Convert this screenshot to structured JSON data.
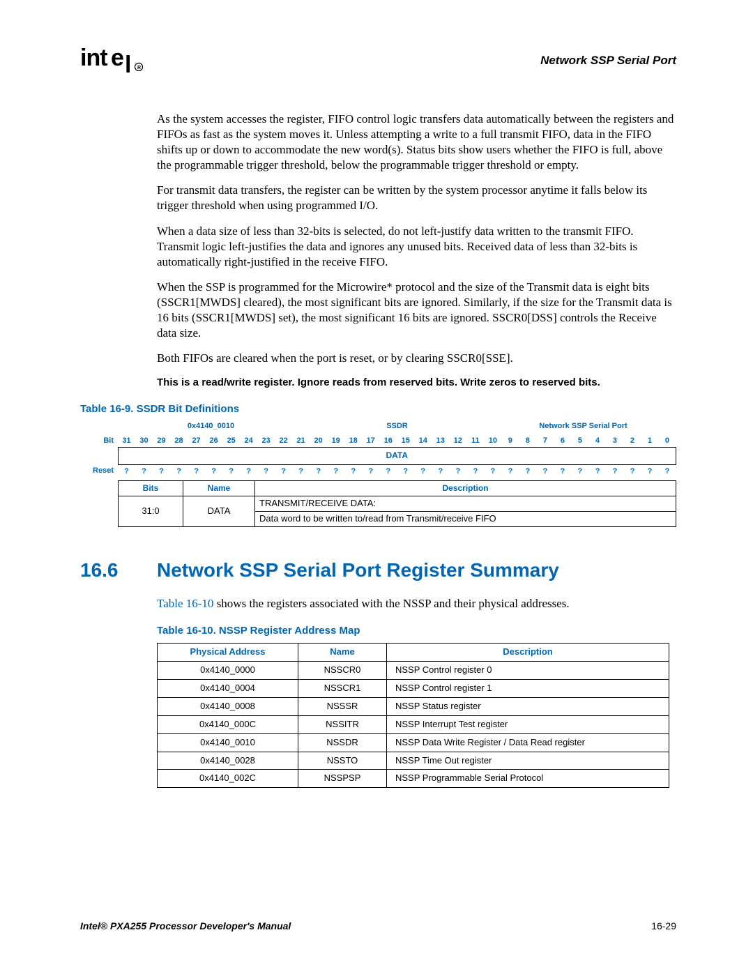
{
  "header": {
    "doc_section": "Network SSP Serial Port"
  },
  "body": {
    "p1": "As the system accesses the register, FIFO control logic transfers data automatically between the registers and FIFOs as fast as the system moves it. Unless attempting a write to a full transmit FIFO, data in the FIFO shifts up or down to accommodate the new word(s). Status bits show users whether the FIFO is full, above the programmable trigger threshold, below the programmable trigger threshold or empty.",
    "p2": "For transmit data transfers, the register can be written by the system processor anytime it falls below its trigger threshold when using programmed I/O.",
    "p3": "When a data size of less than 32-bits is selected, do not left-justify data written to the transmit FIFO. Transmit logic left-justifies the data and ignores any unused bits. Received data of less than 32-bits is automatically right-justified in the receive FIFO.",
    "p4": "When the SSP is programmed for the Microwire* protocol and the size of the Transmit data is eight bits (SSCR1[MWDS] cleared), the most significant bits are ignored. Similarly, if the size for the Transmit data is 16 bits (SSCR1[MWDS] set), the most significant 16 bits are ignored. SSCR0[DSS] controls the Receive data size.",
    "p5": "Both FIFOs are cleared when the port is reset, or by clearing SSCR0[SSE].",
    "note": "This is a read/write register. Ignore reads from reserved bits. Write zeros to reserved bits."
  },
  "table9": {
    "caption": "Table 16-9. SSDR Bit Definitions",
    "address": "0x4140_0010",
    "regname": "SSDR",
    "module": "Network SSP Serial Port",
    "row_bit_label": "Bit",
    "row_data_label": "DATA",
    "row_reset_label": "Reset",
    "bits": [
      "31",
      "30",
      "29",
      "28",
      "27",
      "26",
      "25",
      "24",
      "23",
      "22",
      "21",
      "20",
      "19",
      "18",
      "17",
      "16",
      "15",
      "14",
      "13",
      "12",
      "11",
      "10",
      "9",
      "8",
      "7",
      "6",
      "5",
      "4",
      "3",
      "2",
      "1",
      "0"
    ],
    "reset_vals": [
      "?",
      "?",
      "?",
      "?",
      "?",
      "?",
      "?",
      "?",
      "?",
      "?",
      "?",
      "?",
      "?",
      "?",
      "?",
      "?",
      "?",
      "?",
      "?",
      "?",
      "?",
      "?",
      "?",
      "?",
      "?",
      "?",
      "?",
      "?",
      "?",
      "?",
      "?",
      "?"
    ],
    "cols": {
      "bits": "Bits",
      "name": "Name",
      "desc": "Description"
    },
    "row": {
      "bits": "31:0",
      "name": "DATA",
      "desc_l1": "TRANSMIT/RECEIVE DATA:",
      "desc_l2": "Data word to be written to/read from Transmit/receive FIFO"
    }
  },
  "section": {
    "num": "16.6",
    "title": "Network SSP Serial Port Register Summary",
    "intro_pre": "",
    "intro_xref": "Table 16-10",
    "intro_post": " shows the registers associated with the NSSP and their physical addresses."
  },
  "table10": {
    "caption": "Table 16-10. NSSP Register Address Map",
    "cols": {
      "addr": "Physical Address",
      "name": "Name",
      "desc": "Description"
    },
    "rows": [
      {
        "addr": "0x4140_0000",
        "name": "NSSCR0",
        "desc": "NSSP Control register 0"
      },
      {
        "addr": "0x4140_0004",
        "name": "NSSCR1",
        "desc": "NSSP Control register 1"
      },
      {
        "addr": "0x4140_0008",
        "name": "NSSSR",
        "desc": "NSSP Status register"
      },
      {
        "addr": "0x4140_000C",
        "name": "NSSITR",
        "desc": "NSSP Interrupt Test register"
      },
      {
        "addr": "0x4140_0010",
        "name": "NSSDR",
        "desc": "NSSP Data Write Register / Data Read register"
      },
      {
        "addr": "0x4140_0028",
        "name": "NSSTO",
        "desc": "NSSP Time Out register"
      },
      {
        "addr": "0x4140_002C",
        "name": "NSSPSP",
        "desc": "NSSP Programmable Serial Protocol"
      }
    ]
  },
  "footer": {
    "left": "Intel® PXA255 Processor Developer's Manual",
    "right": "16-29"
  }
}
